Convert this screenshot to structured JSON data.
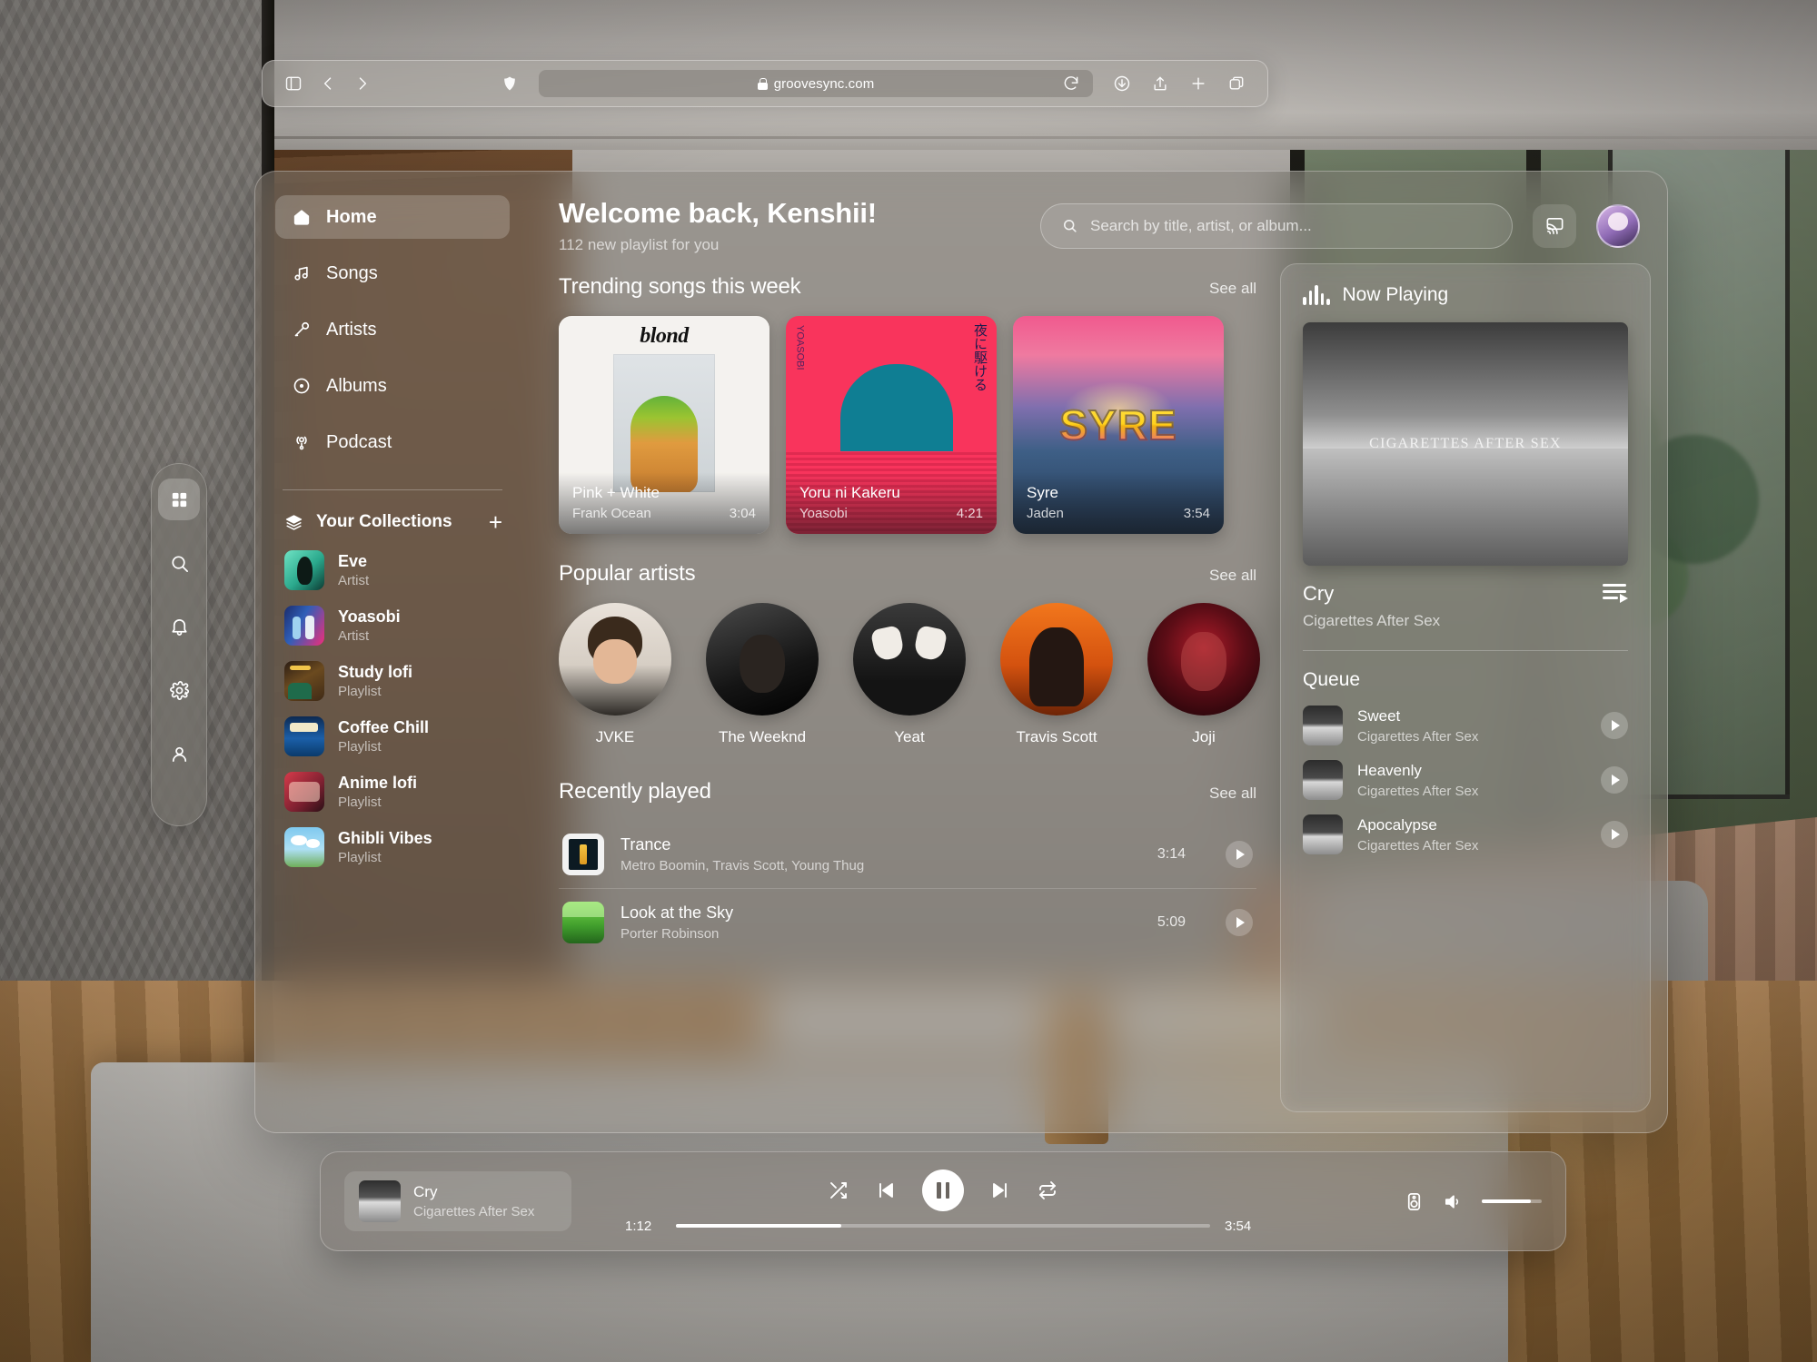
{
  "browser": {
    "url": "groovesync.com",
    "icons": [
      "sidebar-toggle-icon",
      "back-icon",
      "forward-icon",
      "shield-icon",
      "lock-icon",
      "reload-icon",
      "download-icon",
      "share-icon",
      "new-tab-icon",
      "tabs-icon"
    ]
  },
  "dock": {
    "items": [
      {
        "name": "apps-grid-icon",
        "active": true
      },
      {
        "name": "search-icon",
        "active": false
      },
      {
        "name": "bell-icon",
        "active": false
      },
      {
        "name": "gear-icon",
        "active": false
      },
      {
        "name": "person-icon",
        "active": false
      }
    ]
  },
  "sidebar": {
    "nav": [
      {
        "label": "Home",
        "icon": "home-icon",
        "active": true
      },
      {
        "label": "Songs",
        "icon": "music-note-icon",
        "active": false
      },
      {
        "label": "Artists",
        "icon": "microphone-icon",
        "active": false
      },
      {
        "label": "Albums",
        "icon": "disc-icon",
        "active": false
      },
      {
        "label": "Podcast",
        "icon": "podcast-icon",
        "active": false
      }
    ],
    "collections_title": "Your Collections",
    "add_label": "+",
    "collections": [
      {
        "name": "Eve",
        "type": "Artist",
        "art": "th-eve"
      },
      {
        "name": "Yoasobi",
        "type": "Artist",
        "art": "th-yoa"
      },
      {
        "name": "Study lofi",
        "type": "Playlist",
        "art": "th-study"
      },
      {
        "name": "Coffee Chill",
        "type": "Playlist",
        "art": "th-coffee"
      },
      {
        "name": "Anime lofi",
        "type": "Playlist",
        "art": "th-anime"
      },
      {
        "name": "Ghibli Vibes",
        "type": "Playlist",
        "art": "th-ghibli"
      }
    ]
  },
  "header": {
    "welcome": "Welcome back, Kenshii!",
    "subtitle": "112 new playlist for you",
    "search_placeholder": "Search by title, artist, or album...",
    "cast_icon": "cast-icon"
  },
  "trending": {
    "title": "Trending songs this week",
    "see_all": "See all",
    "cards": [
      {
        "title": "Pink + White",
        "artist": "Frank Ocean",
        "duration": "3:04",
        "art": "art-blond",
        "cover_word": "blond"
      },
      {
        "title": "Yoru ni Kakeru",
        "artist": "Yoasobi",
        "duration": "4:21",
        "art": "art-yoru",
        "cover_word": "夜に駆ける"
      },
      {
        "title": "Syre",
        "artist": "Jaden",
        "duration": "3:54",
        "art": "art-syre",
        "cover_word": "SYRE"
      }
    ]
  },
  "artists_section": {
    "title": "Popular artists",
    "see_all": "See all",
    "artists": [
      {
        "name": "JVKE",
        "art": "ar-jvke"
      },
      {
        "name": "The Weeknd",
        "art": "ar-weeknd"
      },
      {
        "name": "Yeat",
        "art": "ar-yeat"
      },
      {
        "name": "Travis Scott",
        "art": "ar-travis"
      },
      {
        "name": "Joji",
        "art": "ar-joji"
      }
    ]
  },
  "recently_played": {
    "title": "Recently played",
    "see_all": "See all",
    "rows": [
      {
        "title": "Trance",
        "artist": "Metro Boomin, Travis Scott, Young Thug",
        "duration": "3:14",
        "art": "th-trance"
      },
      {
        "title": "Look at the Sky",
        "artist": "Porter Robinson",
        "duration": "5:09",
        "art": "th-sky"
      }
    ]
  },
  "now_playing": {
    "title": "Now Playing",
    "cover_caption": "CIGARETTES AFTER SEX",
    "song": "Cry",
    "artist": "Cigarettes After Sex",
    "queue_title": "Queue",
    "queue": [
      {
        "title": "Sweet",
        "artist": "Cigarettes After Sex"
      },
      {
        "title": "Heavenly",
        "artist": "Cigarettes After Sex"
      },
      {
        "title": "Apocalypse",
        "artist": "Cigarettes After Sex"
      }
    ]
  },
  "player": {
    "song": "Cry",
    "artist": "Cigarettes After Sex",
    "elapsed": "1:12",
    "total": "3:54",
    "progress_percent": 31,
    "volume_percent": 82,
    "controls": [
      "shuffle-icon",
      "previous-icon",
      "pause-icon",
      "next-icon",
      "repeat-icon",
      "speaker-device-icon",
      "volume-icon"
    ]
  }
}
